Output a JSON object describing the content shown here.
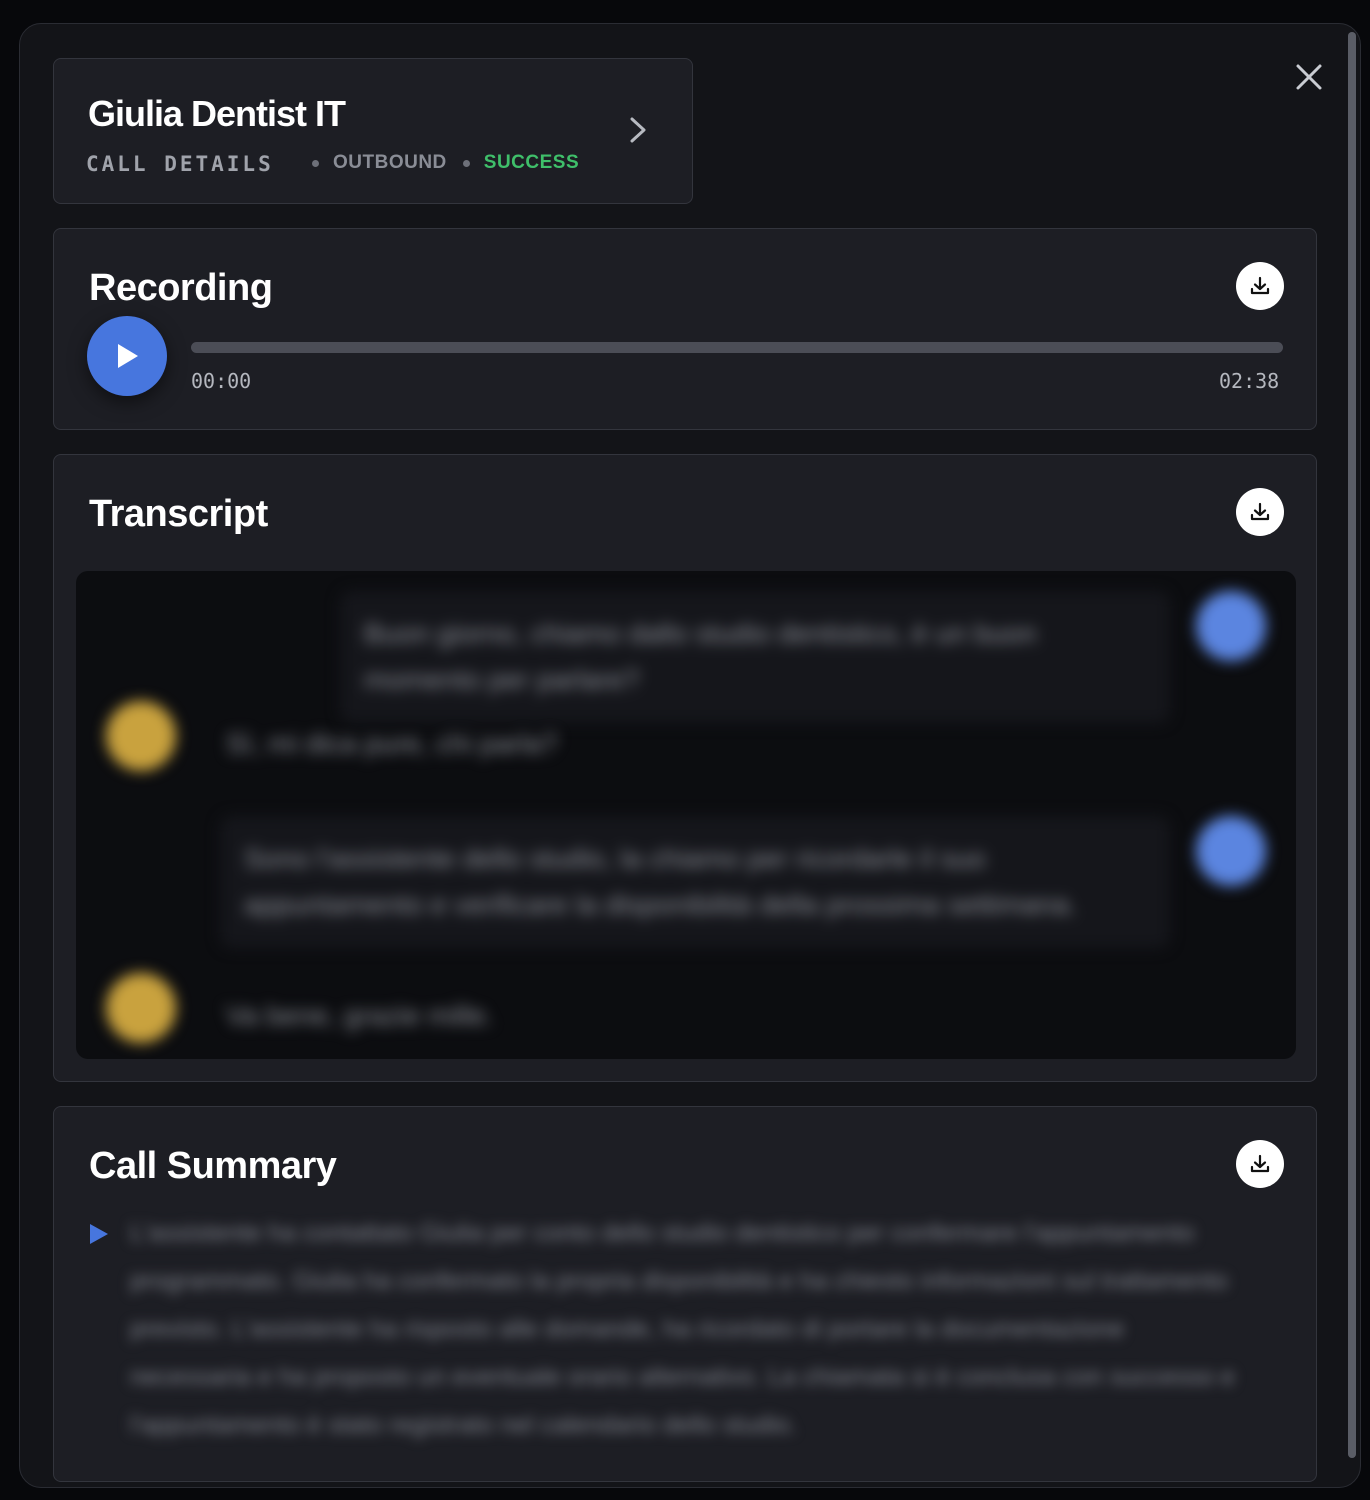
{
  "header": {
    "title": "Giulia Dentist IT",
    "subtitle": "CALL DETAILS",
    "direction": "OUTBOUND",
    "status": "SUCCESS",
    "status_color": "#3fbf6a"
  },
  "recording": {
    "title": "Recording",
    "current_time": "00:00",
    "total_time": "02:38",
    "progress": 0,
    "accent_color": "#4776de"
  },
  "transcript": {
    "title": "Transcript",
    "messages": [
      {
        "role": "agent",
        "text": "Buon giorno, chiamo dallo studio dentistico, è un buon momento per parlare?"
      },
      {
        "role": "user",
        "text": "Sì, mi dica pure, chi parla?"
      },
      {
        "role": "agent",
        "text": "Sono l'assistente dello studio, la chiamo per ricordarle il suo appuntamento e verificare la disponibilità della prossima settimana."
      },
      {
        "role": "user",
        "text": "Va bene, grazie mille."
      }
    ]
  },
  "summary": {
    "title": "Call Summary",
    "text": "L'assistente ha contattato Giulia per conto dello studio dentistico per confermare l'appuntamento programmato. Giulia ha confermato la propria disponibilità e ha chiesto informazioni sul trattamento previsto. L'assistente ha risposto alle domande, ha ricordato di portare la documentazione necessaria e ha proposto un eventuale orario alternativo. La chiamata si è conclusa con successo e l'appuntamento è stato registrato nel calendario dello studio."
  },
  "icons": {
    "close": "close-icon",
    "chevron": "chevron-right-icon",
    "download": "download-icon",
    "play": "play-icon"
  }
}
